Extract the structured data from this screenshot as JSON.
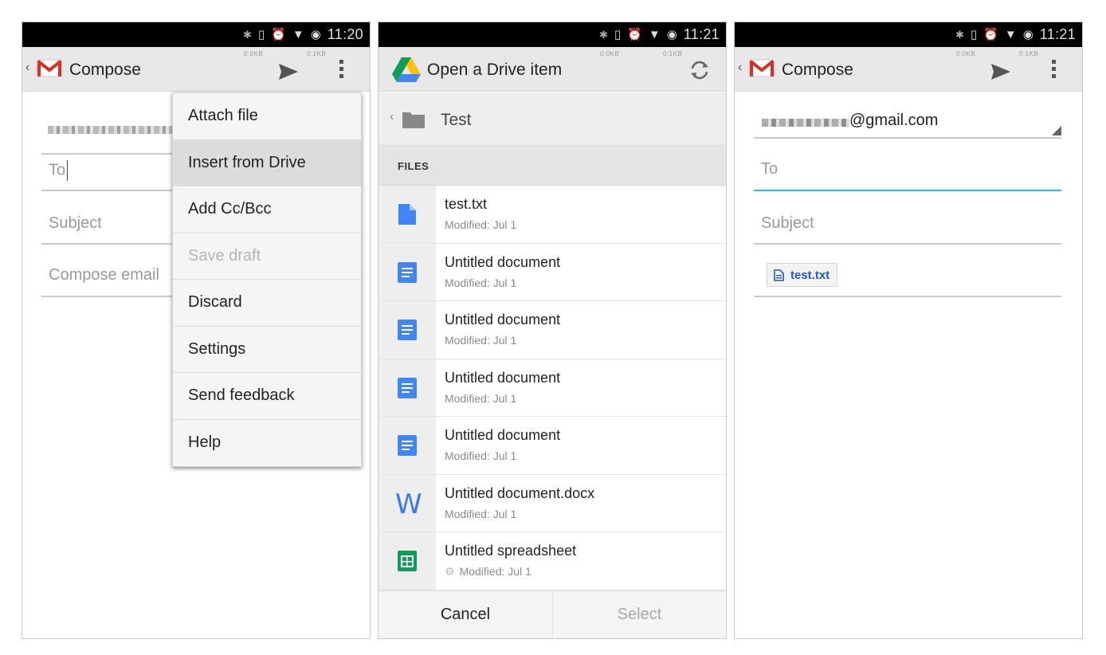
{
  "status_bar": {
    "panel1_time": "11:20",
    "panel2_time": "11:21",
    "panel3_time": "11:21"
  },
  "compose": {
    "title": "Compose",
    "to_placeholder": "To",
    "subject_placeholder": "Subject",
    "body_placeholder": "Compose email",
    "tiny_labels": [
      "0:0KB",
      "0:1KB"
    ]
  },
  "overflow_menu": {
    "items": [
      {
        "label": "Attach file",
        "state": "normal"
      },
      {
        "label": "Insert from Drive",
        "state": "highlighted"
      },
      {
        "label": "Add Cc/Bcc",
        "state": "normal"
      },
      {
        "label": "Save draft",
        "state": "disabled"
      },
      {
        "label": "Discard",
        "state": "normal"
      },
      {
        "label": "Settings",
        "state": "normal"
      },
      {
        "label": "Send feedback",
        "state": "normal"
      },
      {
        "label": "Help",
        "state": "normal"
      }
    ]
  },
  "drive_picker": {
    "title": "Open a Drive item",
    "folder": "Test",
    "section_header": "FILES",
    "files": [
      {
        "name": "test.txt",
        "modified": "Modified: Jul 1",
        "icon": "text-file-icon"
      },
      {
        "name": "Untitled document",
        "modified": "Modified: Jul 1",
        "icon": "doc-icon"
      },
      {
        "name": "Untitled document",
        "modified": "Modified: Jul 1",
        "icon": "doc-icon"
      },
      {
        "name": "Untitled document",
        "modified": "Modified: Jul 1",
        "icon": "doc-icon"
      },
      {
        "name": "Untitled document",
        "modified": "Modified: Jul 1",
        "icon": "doc-icon"
      },
      {
        "name": "Untitled document.docx",
        "modified": "Modified: Jul 1",
        "icon": "word-icon"
      },
      {
        "name": "Untitled spreadsheet",
        "modified": "Modified: Jul 1",
        "icon": "sheet-icon"
      }
    ],
    "cancel_label": "Cancel",
    "select_label": "Select"
  },
  "compose_result": {
    "title": "Compose",
    "from_suffix": "@gmail.com",
    "to_placeholder": "To",
    "subject_placeholder": "Subject",
    "attachment_name": "test.txt"
  },
  "colors": {
    "accent_blue": "#33b5e5",
    "drive_doc_blue": "#3b78e7",
    "sheet_green": "#0f9d58",
    "gmail_red": "#d93025"
  }
}
